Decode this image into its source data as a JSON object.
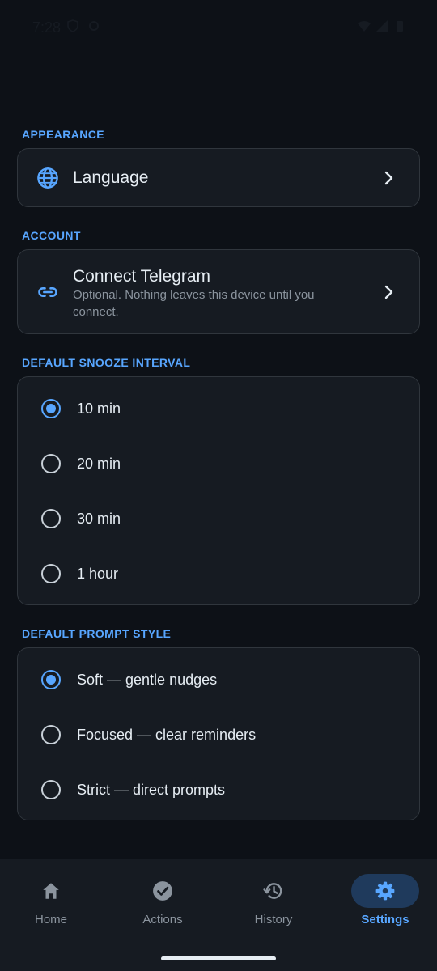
{
  "status_bar": {
    "time": "7:28"
  },
  "sections": {
    "appearance": {
      "title": "APPEARANCE",
      "language_label": "Language"
    },
    "account": {
      "title": "ACCOUNT",
      "telegram_title": "Connect Telegram",
      "telegram_subtitle": "Optional. Nothing leaves this device until you connect."
    },
    "snooze": {
      "title": "DEFAULT SNOOZE INTERVAL",
      "options": [
        "10 min",
        "20 min",
        "30 min",
        "1 hour"
      ],
      "selected": "10 min"
    },
    "prompt_style": {
      "title": "DEFAULT PROMPT STYLE",
      "options": [
        "Soft — gentle nudges",
        "Focused — clear reminders",
        "Strict — direct prompts"
      ],
      "selected": "Soft — gentle nudges"
    }
  },
  "bottom_nav": {
    "items": [
      {
        "label": "Home",
        "icon": "home-icon"
      },
      {
        "label": "Actions",
        "icon": "check-circle-icon"
      },
      {
        "label": "History",
        "icon": "history-icon"
      },
      {
        "label": "Settings",
        "icon": "gear-icon"
      }
    ],
    "active": "Settings"
  },
  "colors": {
    "background": "#0d1117",
    "card": "#161b22",
    "accent": "#58a6ff",
    "active_pill": "#1f3a5c"
  }
}
